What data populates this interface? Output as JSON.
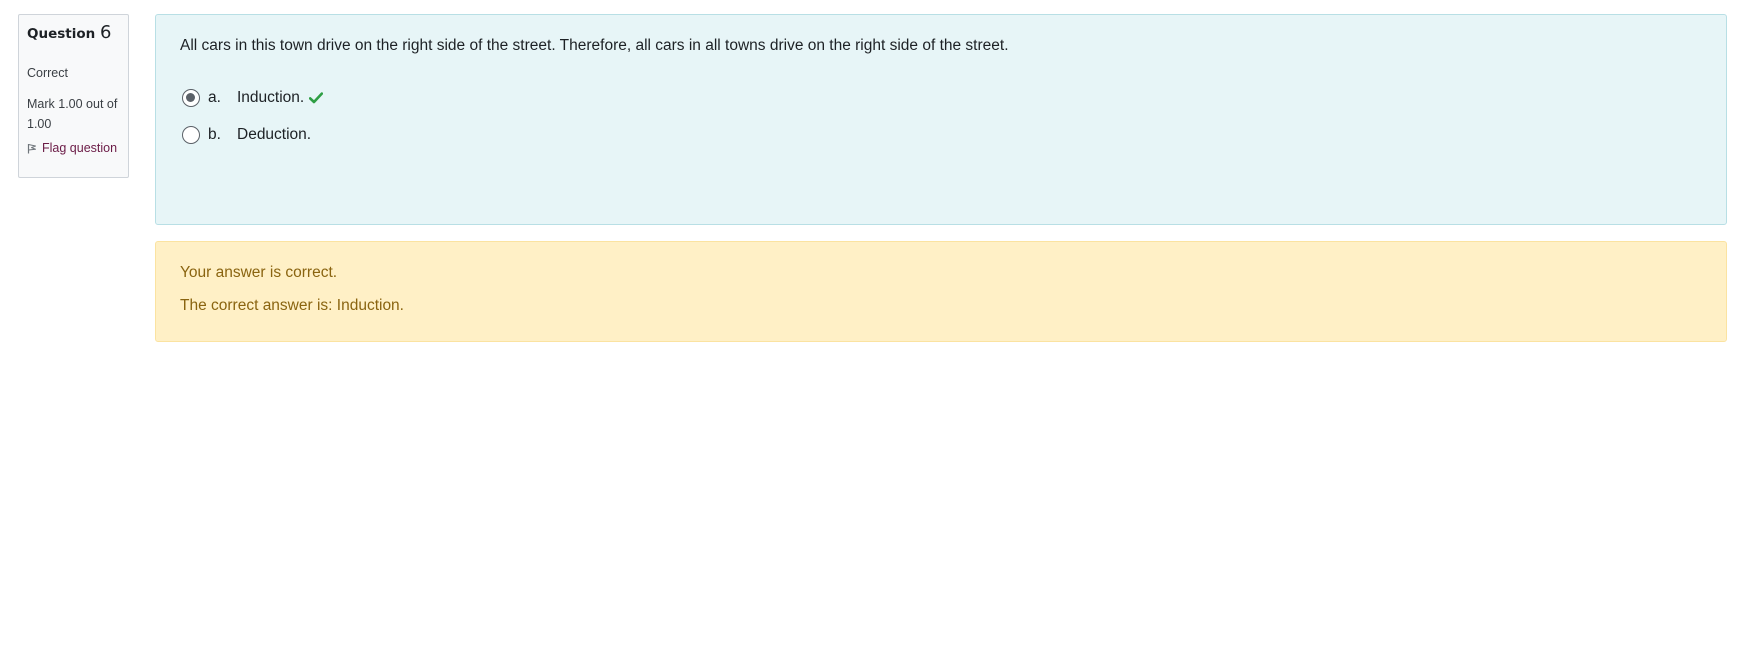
{
  "info": {
    "question_label": "Question",
    "question_number": "6",
    "state": "Correct",
    "grade": "Mark 1.00 out of 1.00",
    "flag_label": "Flag question"
  },
  "question": {
    "text": "All cars in this town drive on the right side of the street. Therefore, all cars in all towns drive on the right side of the street.",
    "answers": [
      {
        "letter": "a.",
        "label": "Induction.",
        "selected": true,
        "correct_mark": true
      },
      {
        "letter": "b.",
        "label": "Deduction.",
        "selected": false,
        "correct_mark": false
      }
    ]
  },
  "feedback": {
    "status": "Your answer is correct.",
    "right_answer": "The correct answer is: Induction."
  },
  "colors": {
    "info_bg": "#f8f9fa",
    "question_bg": "#e7f5f7",
    "feedback_bg": "#fff0c6",
    "feedback_text": "#8a6410",
    "flag_link": "#6b1b46",
    "check_green": "#2e9e44"
  },
  "icons": {
    "flag": "flag-icon",
    "correct": "check-icon"
  }
}
